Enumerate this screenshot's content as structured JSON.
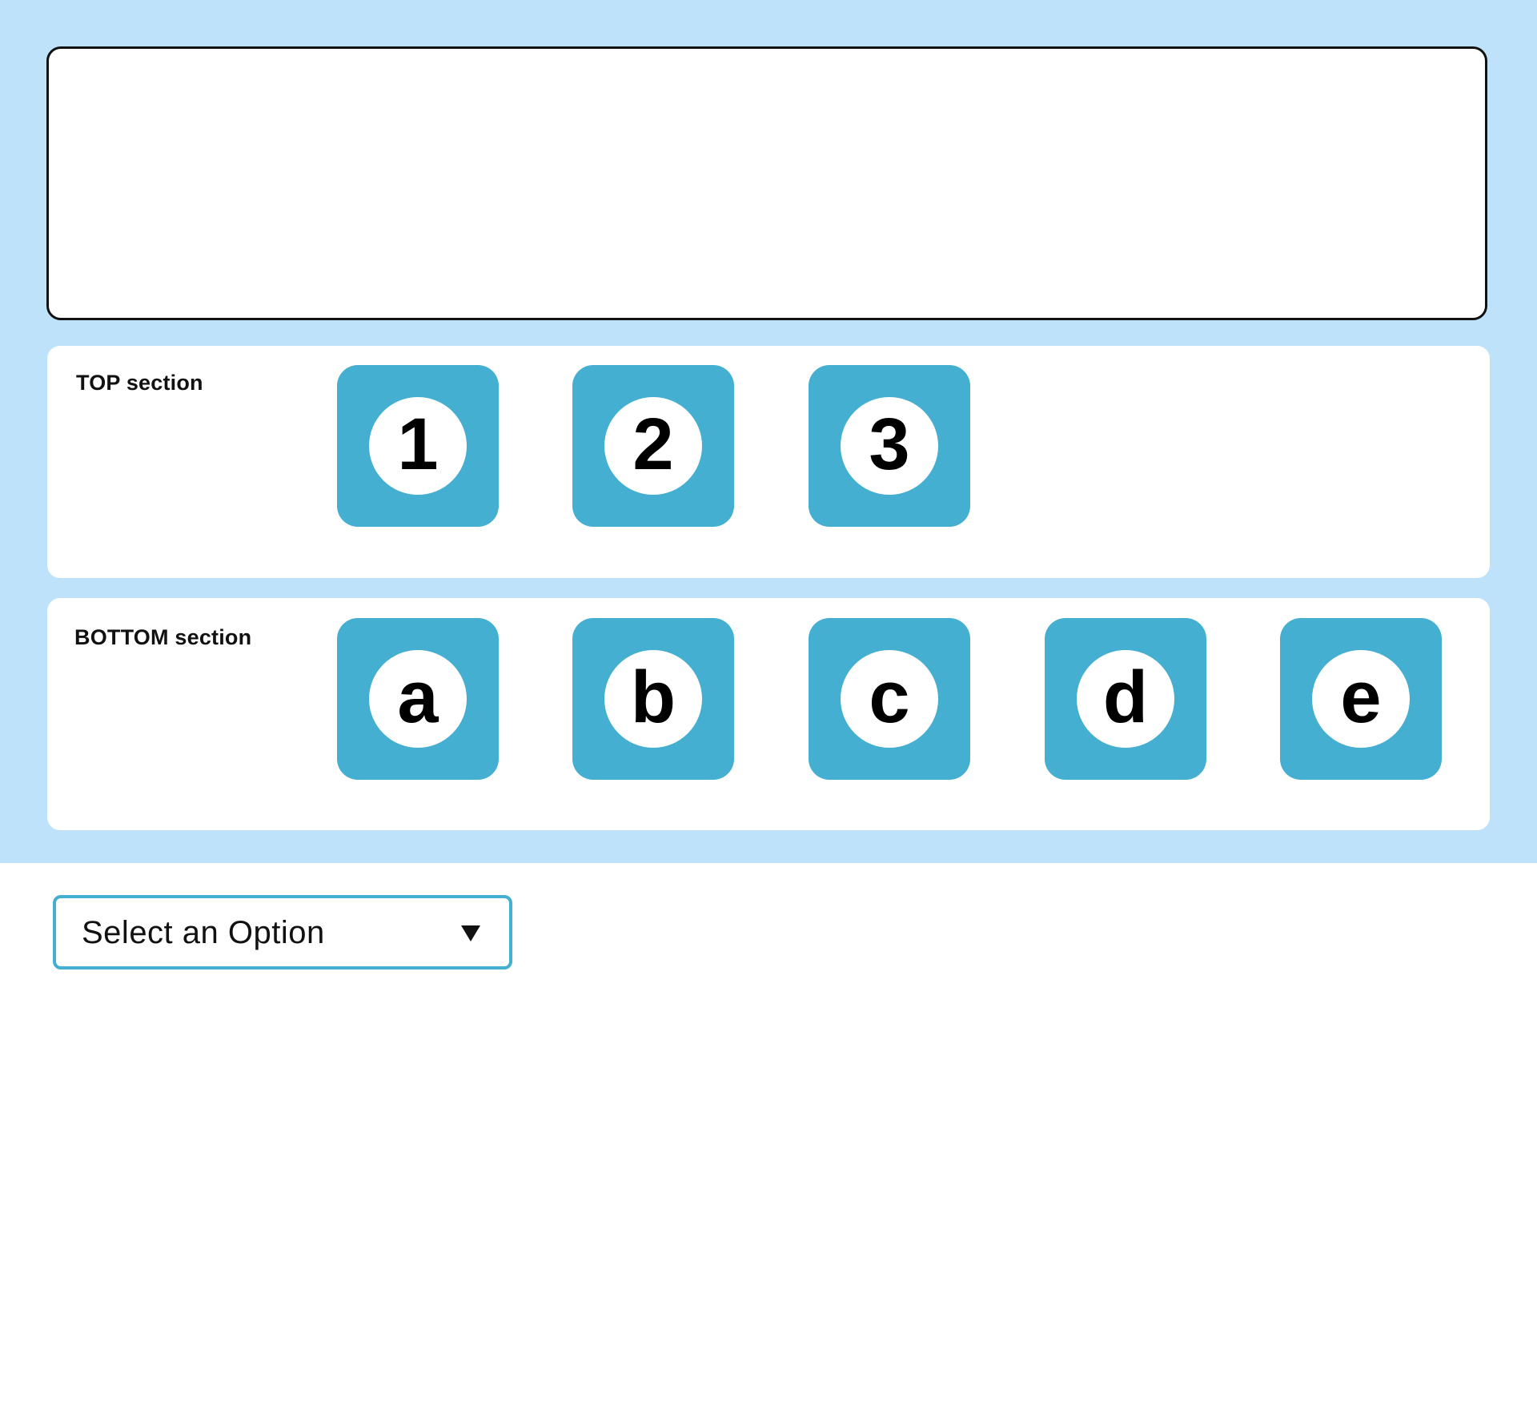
{
  "top_section": {
    "label": "TOP section",
    "tiles": [
      {
        "value": "1"
      },
      {
        "value": "2"
      },
      {
        "value": "3"
      }
    ]
  },
  "bottom_section": {
    "label": "BOTTOM section",
    "tiles": [
      {
        "value": "a"
      },
      {
        "value": "b"
      },
      {
        "value": "c"
      },
      {
        "value": "d"
      },
      {
        "value": "e"
      }
    ]
  },
  "select": {
    "value": "Select an Option"
  },
  "colors": {
    "background_band": "#bfe2fb",
    "tile_fill": "#44afd0",
    "select_border": "#44afd0"
  }
}
